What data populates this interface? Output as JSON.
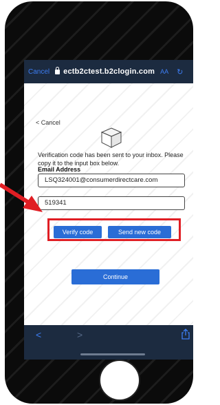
{
  "browser": {
    "cancel_label": "Cancel",
    "url": "ectb2ctest.b2clogin.com",
    "text_size_label": "AA",
    "reload_icon": "reload-icon"
  },
  "page": {
    "cancel_label": "< Cancel",
    "info_text": "Verification code has been sent to your inbox. Please copy it to the input box below.",
    "email_label": "Email Address",
    "email_value": "LSQ324001@consumerdirectcare.com",
    "code_value": "519341",
    "verify_button": "Verify code",
    "send_new_button": "Send new code",
    "continue_button": "Continue"
  },
  "colors": {
    "accent": "#2a6dd6",
    "highlight": "#e01e24",
    "browser_bar": "#1c2b40"
  }
}
